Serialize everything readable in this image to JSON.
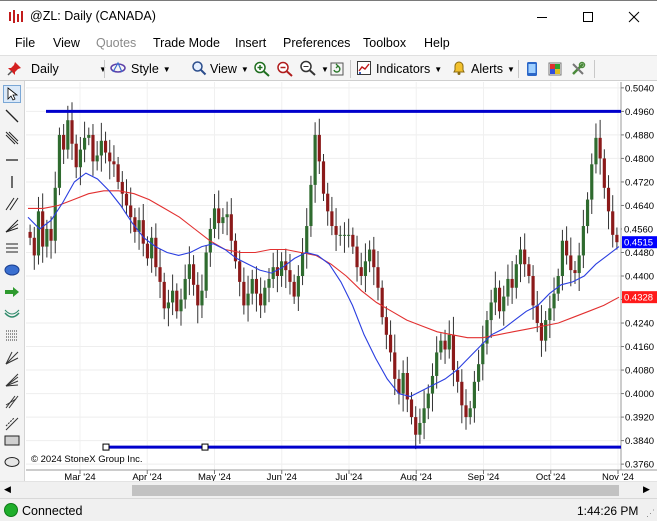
{
  "window": {
    "title": "@ZL: Daily (CANADA)"
  },
  "menu": [
    "File",
    "View",
    "Quotes",
    "Trade Mode",
    "Insert",
    "Preferences",
    "Toolbox",
    "Help"
  ],
  "menu_disabled": [
    "Quotes"
  ],
  "toolbar": {
    "interval": "Daily",
    "style_label": "Style",
    "view_label": "View",
    "indicators_label": "Indicators",
    "alerts_label": "Alerts"
  },
  "chart": {
    "symbol": "@ZL",
    "copyright": "© 2024 StoneX Group Inc.",
    "price_labels": [
      "0.5040",
      "0.4960",
      "0.4880",
      "0.4800",
      "0.4720",
      "0.4640",
      "0.4560",
      "0.4480",
      "0.4400",
      "0.4320",
      "0.4240",
      "0.4160",
      "0.4080",
      "0.4000",
      "0.3920",
      "0.3840",
      "0.3760"
    ],
    "date_labels": [
      "Mar '24",
      "Apr '24",
      "May '24",
      "Jun '24",
      "Jul '24",
      "Aug '24",
      "Sep '24",
      "Oct '24",
      "Nov '24"
    ],
    "current_price": "0.4515",
    "ma_long_value": "0.4328",
    "partial_label": "0.4560",
    "colors": {
      "up": "#2f6b2f",
      "down": "#8b1a1a",
      "ma_short": "#2a3ee0",
      "ma_long": "#e23030",
      "hline": "#0000cc"
    }
  },
  "chart_data": {
    "type": "candlestick",
    "x": [
      "Mar '24",
      "Apr '24",
      "May '24",
      "Jun '24",
      "Jul '24",
      "Aug '24",
      "Sep '24",
      "Oct '24",
      "Nov '24"
    ],
    "ylim": [
      0.374,
      0.506
    ],
    "horizontal_lines": [
      0.496,
      0.3818
    ],
    "close_path": [
      0.453,
      0.447,
      0.462,
      0.45,
      0.456,
      0.452,
      0.47,
      0.488,
      0.483,
      0.493,
      0.485,
      0.477,
      0.483,
      0.487,
      0.488,
      0.479,
      0.481,
      0.486,
      0.482,
      0.479,
      0.478,
      0.472,
      0.468,
      0.464,
      0.46,
      0.455,
      0.459,
      0.451,
      0.446,
      0.453,
      0.443,
      0.438,
      0.429,
      0.431,
      0.435,
      0.428,
      0.432,
      0.439,
      0.444,
      0.437,
      0.43,
      0.435,
      0.448,
      0.456,
      0.463,
      0.458,
      0.46,
      0.461,
      0.452,
      0.445,
      0.438,
      0.43,
      0.434,
      0.439,
      0.434,
      0.43,
      0.436,
      0.439,
      0.443,
      0.44,
      0.445,
      0.442,
      0.438,
      0.433,
      0.44,
      0.448,
      0.457,
      0.471,
      0.488,
      0.479,
      0.468,
      0.462,
      0.457,
      0.454,
      0.454,
      0.454,
      0.454,
      0.45,
      0.443,
      0.44,
      0.445,
      0.449,
      0.443,
      0.436,
      0.426,
      0.42,
      0.414,
      0.405,
      0.4,
      0.407,
      0.398,
      0.392,
      0.386,
      0.39,
      0.395,
      0.4,
      0.406,
      0.414,
      0.418,
      0.415,
      0.42,
      0.408,
      0.404,
      0.396,
      0.392,
      0.395,
      0.404,
      0.41,
      0.417,
      0.425,
      0.431,
      0.436,
      0.428,
      0.433,
      0.439,
      0.436,
      0.444,
      0.449,
      0.444,
      0.44,
      0.43,
      0.424,
      0.418,
      0.425,
      0.429,
      0.434,
      0.44,
      0.452,
      0.447,
      0.442,
      0.441,
      0.447,
      0.457,
      0.466,
      0.478,
      0.487,
      0.48,
      0.47,
      0.462,
      0.454,
      0.4515
    ],
    "series": [
      {
        "name": "MA short",
        "values": [
          0.46,
          0.456,
          0.459,
          0.465,
          0.472,
          0.475,
          0.473,
          0.469,
          0.464,
          0.458,
          0.453,
          0.45,
          0.448,
          0.447,
          0.448,
          0.45,
          0.451,
          0.449,
          0.446,
          0.444,
          0.442,
          0.441,
          0.443,
          0.446,
          0.448,
          0.447,
          0.444,
          0.438,
          0.43,
          0.42,
          0.412,
          0.405,
          0.4,
          0.399,
          0.401,
          0.403,
          0.405,
          0.408,
          0.412,
          0.416,
          0.42,
          0.422,
          0.425,
          0.428,
          0.43,
          0.434,
          0.437,
          0.438,
          0.44,
          0.444,
          0.447,
          0.45
        ]
      },
      {
        "name": "MA long",
        "values": [
          0.463,
          0.463,
          0.464,
          0.466,
          0.468,
          0.469,
          0.469,
          0.468,
          0.466,
          0.463,
          0.46,
          0.456,
          0.452,
          0.449,
          0.448,
          0.448,
          0.449,
          0.449,
          0.448,
          0.447,
          0.444,
          0.44,
          0.435,
          0.431,
          0.428,
          0.425,
          0.423,
          0.421,
          0.42,
          0.419,
          0.419,
          0.42,
          0.421,
          0.422,
          0.423,
          0.424,
          0.426,
          0.428,
          0.43,
          0.4328
        ]
      }
    ]
  },
  "status": {
    "connection": "Connected",
    "time": "1:44:26 PM"
  }
}
